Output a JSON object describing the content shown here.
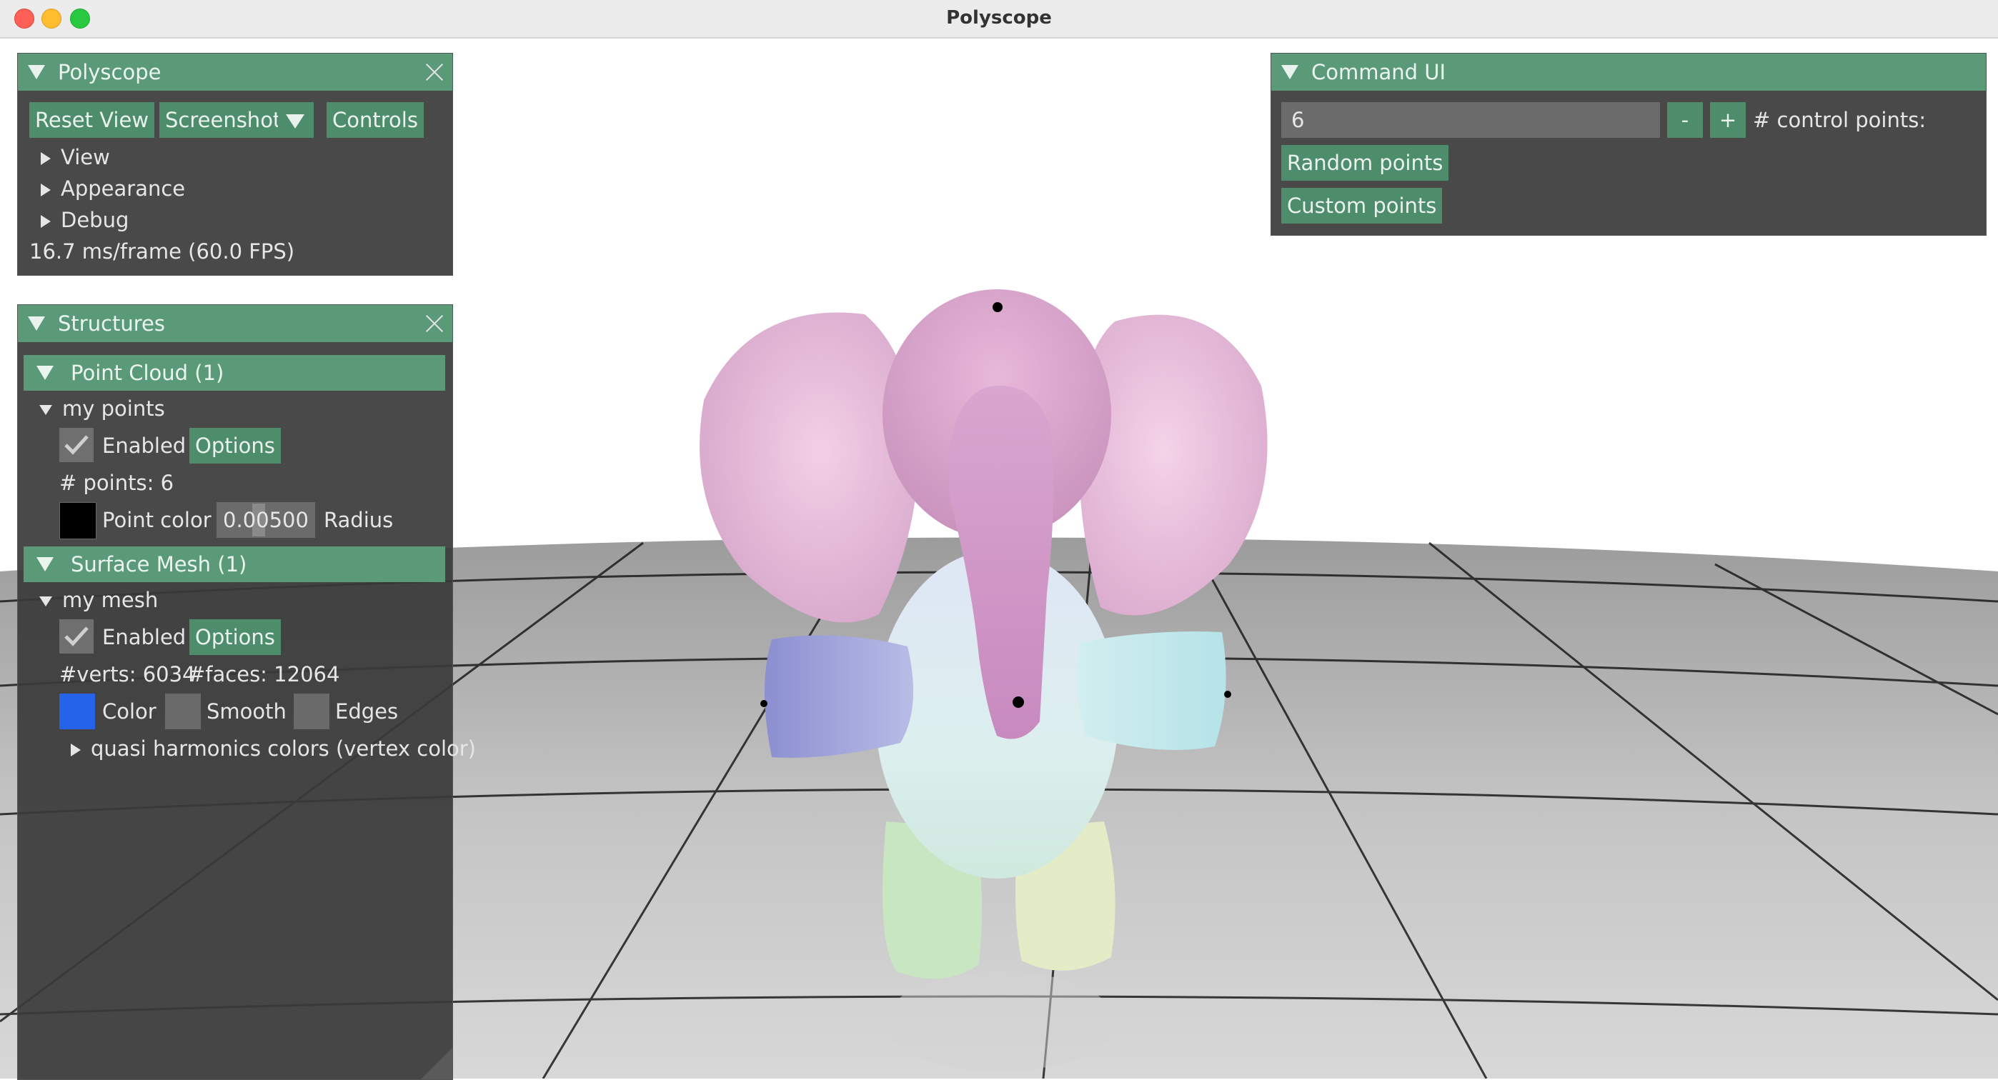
{
  "window": {
    "title": "Polyscope"
  },
  "polyscope_panel": {
    "title": "Polyscope",
    "buttons": {
      "reset_view": "Reset View",
      "screenshot": "Screenshot",
      "controls": "Controls"
    },
    "tree": [
      "View",
      "Appearance",
      "Debug"
    ],
    "fps": "16.7 ms/frame (60.0 FPS)"
  },
  "structures_panel": {
    "title": "Structures",
    "point_cloud": {
      "header": "Point Cloud (1)",
      "item": "my points",
      "enabled_label": "Enabled",
      "enabled": true,
      "options_label": "Options",
      "count": "# points: 6",
      "color_label": "Point color",
      "color": "#000000",
      "radius_value": "0.00500",
      "radius_label": "Radius"
    },
    "surface_mesh": {
      "header": "Surface Mesh (1)",
      "item": "my mesh",
      "enabled_label": "Enabled",
      "enabled": true,
      "options_label": "Options",
      "verts": "#verts: 6034",
      "faces": "#faces: 12064",
      "color_label": "Color",
      "color": "#2563eb",
      "smooth_label": "Smooth",
      "edges_label": "Edges",
      "quantity": "quasi harmonics colors (vertex color)"
    }
  },
  "command_panel": {
    "title": "Command UI",
    "control_points_value": "6",
    "minus": "-",
    "plus": "+",
    "control_points_label": "# control points:",
    "random_button": "Random points",
    "custom_button": "Custom points"
  },
  "colors": {
    "accent": "#5a9a78",
    "panel_bg": "#3a3a3a"
  }
}
